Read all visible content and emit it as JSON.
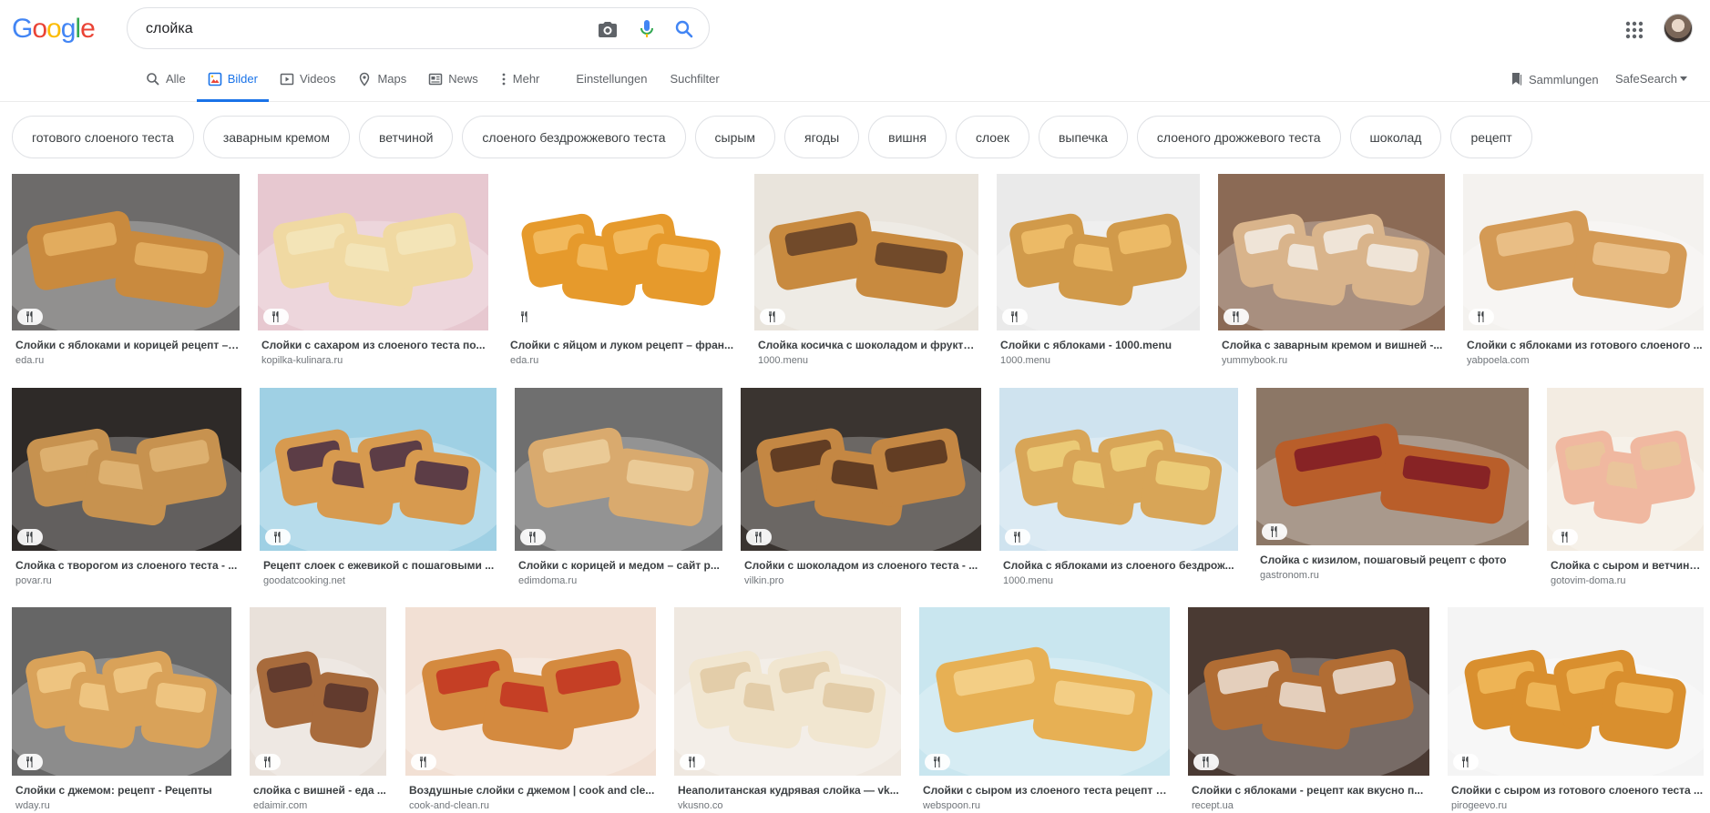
{
  "logo": {
    "letters": [
      "G",
      "o",
      "o",
      "g",
      "l",
      "e"
    ],
    "colors": [
      "#4285f4",
      "#ea4335",
      "#fbbc05",
      "#4285f4",
      "#34a853",
      "#ea4335"
    ]
  },
  "search": {
    "value": "слойка",
    "camera_icon": "camera-icon",
    "mic_icon": "mic-icon",
    "search_icon": "search-icon"
  },
  "tabs": {
    "all": "Alle",
    "images": "Bilder",
    "videos": "Videos",
    "maps": "Maps",
    "news": "News",
    "more": "Mehr",
    "settings": "Einstellungen",
    "tools": "Suchfilter"
  },
  "right_tools": {
    "collections": "Sammlungen",
    "safesearch": "SafeSearch"
  },
  "chips": [
    "готового слоеного теста",
    "заварным кремом",
    "ветчиной",
    "слоеного бездрожжевого теста",
    "сырым",
    "ягоды",
    "вишня",
    "слоек",
    "выпечка",
    "слоеного дрожжевого теста",
    "шоколад",
    "рецепт"
  ],
  "results": [
    {
      "title": "Слойки с яблоками и корицей рецепт – ...",
      "source": "eda.ru"
    },
    {
      "title": "Слойки с сахаром из слоеного теста по...",
      "source": "kopilka-kulinara.ru"
    },
    {
      "title": "Слойки с яйцом и луком рецепт – фран...",
      "source": "eda.ru"
    },
    {
      "title": "Слойка косичка с шоколадом и фрукта...",
      "source": "1000.menu"
    },
    {
      "title": "Слойки с яблоками - 1000.menu",
      "source": "1000.menu"
    },
    {
      "title": "Слойка с заварным кремом и вишней -...",
      "source": "yummybook.ru"
    },
    {
      "title": "Слойки с яблоками из готового слоеного ...",
      "source": "yabpoela.com"
    },
    {
      "title": "Слойка с творогом из слоеного теста - ...",
      "source": "povar.ru"
    },
    {
      "title": "Рецепт слоек с ежевикой с пошаговыми ...",
      "source": "goodatcooking.net"
    },
    {
      "title": "Слойки с корицей и медом – сайт р...",
      "source": "edimdoma.ru"
    },
    {
      "title": "Слойки с шоколадом из слоеного теста - ...",
      "source": "vilkin.pro"
    },
    {
      "title": "Слойка с яблоками из слоеного бездрож...",
      "source": "1000.menu"
    },
    {
      "title": "Слойка с кизилом, пошаговый рецепт с фото",
      "source": "gastronom.ru"
    },
    {
      "title": "Слойка с сыром и ветчино...",
      "source": "gotovim-doma.ru"
    },
    {
      "title": "Слойки с джемом: рецепт - Рецепты",
      "source": "wday.ru"
    },
    {
      "title": "слойка с вишней - еда ...",
      "source": "edaimir.com"
    },
    {
      "title": "Воздушные слойки с джемом | cook and cle...",
      "source": "cook-and-clean.ru"
    },
    {
      "title": "Неаполитанская кудрявая слойка — vk...",
      "source": "vkusno.co"
    },
    {
      "title": "Слойки с сыром из слоеного теста рецепт с...",
      "source": "webspoon.ru"
    },
    {
      "title": "Слойки с яблоками - рецепт как вкусно п...",
      "source": "recept.ua"
    },
    {
      "title": "Слойки с сыром из готового слоеного теста ...",
      "source": "pirogeevo.ru"
    }
  ],
  "colors": {
    "accent": "#1a73e8",
    "text_secondary": "#5f6368",
    "border": "#dfe1e5"
  }
}
